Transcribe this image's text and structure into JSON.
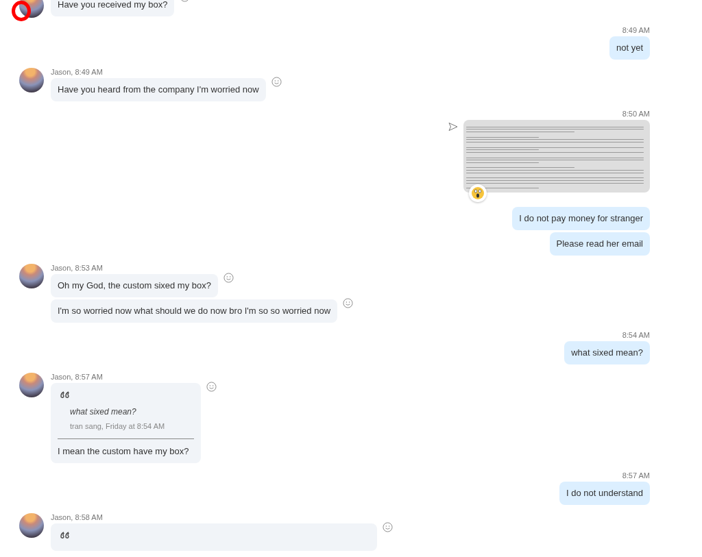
{
  "conversation": [
    {
      "kind": "incoming",
      "messages": [
        {
          "kind": "text",
          "text": "Have you received my box?"
        }
      ]
    },
    {
      "kind": "outgoing",
      "time": "8:49 AM",
      "messages": [
        {
          "kind": "text",
          "text": "not yet"
        }
      ]
    },
    {
      "kind": "incoming",
      "header": "Jason, 8:49 AM",
      "messages": [
        {
          "kind": "text",
          "text": "Have you heard from the company I'm worried now"
        }
      ]
    },
    {
      "kind": "outgoing",
      "time": "8:50 AM",
      "messages": [
        {
          "kind": "image",
          "sent": true,
          "reaction": true
        },
        {
          "kind": "text",
          "text": "I do not pay money for stranger"
        },
        {
          "kind": "text",
          "text": "Please read her email"
        }
      ]
    },
    {
      "kind": "incoming",
      "header": "Jason, 8:53 AM",
      "messages": [
        {
          "kind": "text",
          "text": "Oh my God, the custom sixed my box?"
        },
        {
          "kind": "text",
          "text": "I'm so worried now what should we do now bro I'm so so worried now"
        }
      ]
    },
    {
      "kind": "outgoing",
      "time": "8:54 AM",
      "messages": [
        {
          "kind": "text",
          "text": "what sixed mean?"
        }
      ]
    },
    {
      "kind": "incoming",
      "header": "Jason, 8:57 AM",
      "messages": [
        {
          "kind": "quote",
          "quote": "what sixed mean?",
          "source": "tran sang, Friday at 8:54 AM",
          "text": "I mean the custom have my box?"
        }
      ]
    },
    {
      "kind": "outgoing",
      "time": "8:57 AM",
      "messages": [
        {
          "kind": "text",
          "text": "I do not understand"
        }
      ]
    },
    {
      "kind": "incoming",
      "header": "Jason, 8:58 AM",
      "messages": [
        {
          "kind": "quote",
          "wide": true
        }
      ]
    }
  ]
}
